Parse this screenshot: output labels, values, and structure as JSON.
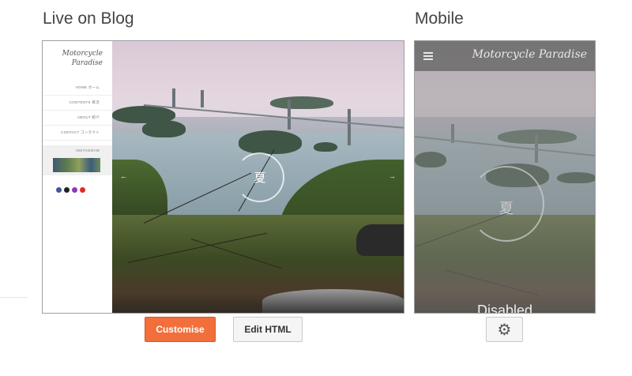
{
  "sections": {
    "live_title": "Live on Blog",
    "mobile_title": "Mobile"
  },
  "desktop_preview": {
    "blog_title": "Motorcycle Paradise",
    "nav_items": [
      "HOME ホーム",
      "CONTENTS 目次",
      "ABOUT 紹介",
      "CONTACT コンタクト"
    ],
    "instagram_label": "INSTAGRAM",
    "social_icons": [
      "facebook-icon",
      "twitter-icon",
      "instagram-icon",
      "youtube-icon"
    ],
    "social_colors": [
      "#3b5998",
      "#222222",
      "#8a3ab9",
      "#e02a20"
    ],
    "slide_text": "夏",
    "prev_arrow": "←",
    "next_arrow": "→"
  },
  "mobile_preview": {
    "title": "Motorcycle Paradise",
    "slide_text": "夏",
    "status": "Disabled"
  },
  "actions": {
    "customise_label": "Customise",
    "edit_html_label": "Edit HTML",
    "settings_icon": "gear-icon",
    "accent": "#f26f3b"
  }
}
